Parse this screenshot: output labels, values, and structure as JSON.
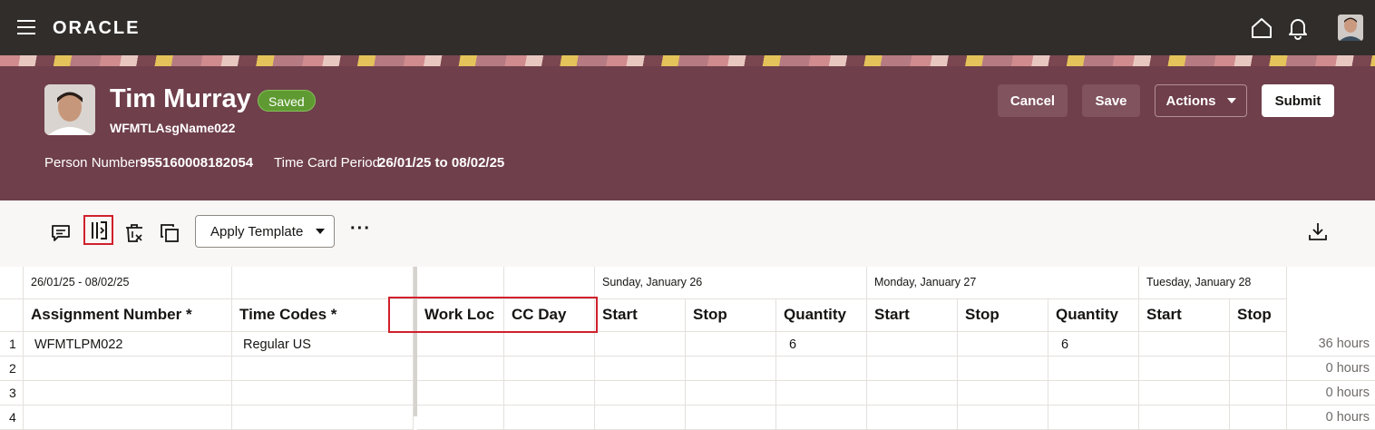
{
  "topbar": {
    "logo": "ORACLE",
    "icons": [
      "hamburger-menu-icon",
      "home-icon",
      "bell-icon",
      "user-avatar"
    ]
  },
  "person": {
    "name": "Tim Murray",
    "status": "Saved",
    "assignment_name": "WFMTLAsgName022",
    "person_number_label": "Person Number",
    "person_number": "955160008182054",
    "period_label": "Time Card Period",
    "period_value": "26/01/25 to 08/02/25"
  },
  "header_actions": {
    "cancel": "Cancel",
    "save": "Save",
    "actions": "Actions",
    "submit": "Submit"
  },
  "toolbar": {
    "icons": [
      "comment-icon",
      "columns-icon",
      "delete-icon",
      "copy-icon",
      "more-icon",
      "download-icon"
    ],
    "apply_template": "Apply Template",
    "more": "···"
  },
  "grid": {
    "date_range": "26/01/25 - 08/02/25",
    "days": [
      "Sunday, January 26",
      "Monday, January 27",
      "Tuesday, January 28"
    ],
    "columns": [
      "Assignment Number *",
      "Time Codes *",
      "Work Loc",
      "CC Day",
      "Start",
      "Stop",
      "Quantity",
      "Start",
      "Stop",
      "Quantity",
      "Start",
      "Stop"
    ],
    "rows": [
      {
        "num": "1",
        "assignment": "WFMTLPM022",
        "time_code": "Regular US",
        "sun_qty": "6",
        "mon_qty": "6",
        "total": "36 hours"
      },
      {
        "num": "2",
        "assignment": "",
        "time_code": "",
        "sun_qty": "",
        "mon_qty": "",
        "total": "0 hours"
      },
      {
        "num": "3",
        "assignment": "",
        "time_code": "",
        "sun_qty": "",
        "mon_qty": "",
        "total": "0 hours"
      },
      {
        "num": "4",
        "assignment": "",
        "time_code": "",
        "sun_qty": "",
        "mon_qty": "",
        "total": "0 hours"
      }
    ]
  },
  "colors": {
    "topbar": "#312d2a",
    "header": "#6f3f4b",
    "saved_badge": "#5e9a31",
    "highlight": "#d0202c"
  }
}
